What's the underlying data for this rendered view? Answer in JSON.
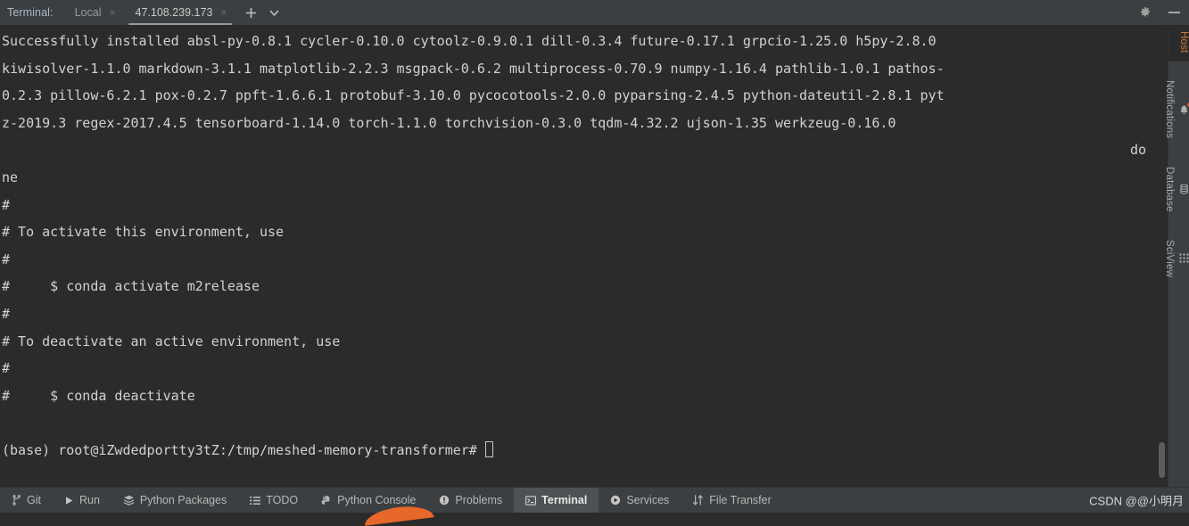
{
  "window": {
    "title_label": "Terminal:",
    "gear_icon": "gear-icon",
    "minimize_icon": "minimize-icon",
    "add_icon": "+",
    "dropdown_icon": "ˇ"
  },
  "tabs": [
    {
      "label": "Local",
      "active": false,
      "close_icon": "×"
    },
    {
      "label": "47.108.239.173",
      "active": true,
      "close_icon": "×"
    }
  ],
  "terminal": {
    "lines": [
      {
        "text": "Successfully installed absl-py-0.8.1 cycler-0.10.0 cytoolz-0.9.0.1 dill-0.3.4 future-0.17.1 grpcio-1.25.0 h5py-2.8.0",
        "align": "left"
      },
      {
        "text": "kiwisolver-1.1.0 markdown-3.1.1 matplotlib-2.2.3 msgpack-0.6.2 multiprocess-0.70.9 numpy-1.16.4 pathlib-1.0.1 pathos-",
        "align": "left"
      },
      {
        "text": "0.2.3 pillow-6.2.1 pox-0.2.7 ppft-1.6.6.1 protobuf-3.10.0 pycocotools-2.0.0 pyparsing-2.4.5 python-dateutil-2.8.1 pyt",
        "align": "left"
      },
      {
        "text": "z-2019.3 regex-2017.4.5 tensorboard-1.14.0 torch-1.1.0 torchvision-0.3.0 tqdm-4.32.2 ujson-1.35 werkzeug-0.16.0",
        "align": "left"
      },
      {
        "text": "do",
        "align": "right"
      },
      {
        "text": "ne",
        "align": "left"
      },
      {
        "text": "#",
        "align": "left"
      },
      {
        "text": "# To activate this environment, use",
        "align": "left"
      },
      {
        "text": "#",
        "align": "left"
      },
      {
        "text": "#     $ conda activate m2release",
        "align": "left"
      },
      {
        "text": "#",
        "align": "left"
      },
      {
        "text": "# To deactivate an active environment, use",
        "align": "left"
      },
      {
        "text": "#",
        "align": "left"
      },
      {
        "text": "#     $ conda deactivate",
        "align": "left"
      },
      {
        "text": "",
        "align": "left"
      }
    ],
    "prompt": "(base) root@iZwdedportty3tZ:/tmp/meshed-memory-transformer#"
  },
  "right_rail": [
    {
      "label": "Host",
      "icon": "",
      "active": true,
      "badge": false
    },
    {
      "label": "Notifications",
      "icon": "notification-bell-icon",
      "active": false,
      "badge": true
    },
    {
      "label": "Database",
      "icon": "database-icon",
      "active": false,
      "badge": false
    },
    {
      "label": "SciView",
      "icon": "sciview-grid-icon",
      "active": false,
      "badge": false
    }
  ],
  "status_bar": {
    "items": [
      {
        "label": "Git",
        "icon": "git-branch-icon",
        "active": false
      },
      {
        "label": "Run",
        "icon": "run-play-icon",
        "active": false
      },
      {
        "label": "Python Packages",
        "icon": "packages-stack-icon",
        "active": false
      },
      {
        "label": "TODO",
        "icon": "todo-list-icon",
        "active": false
      },
      {
        "label": "Python Console",
        "icon": "python-console-icon",
        "active": false
      },
      {
        "label": "Problems",
        "icon": "problems-warning-icon",
        "active": false
      },
      {
        "label": "Terminal",
        "icon": "terminal-prompt-icon",
        "active": true
      },
      {
        "label": "Services",
        "icon": "services-play-icon",
        "active": false
      },
      {
        "label": "File Transfer",
        "icon": "file-transfer-arrows-icon",
        "active": false
      }
    ],
    "watermark": "CSDN @@小明月"
  },
  "colors": {
    "terminal_bg": "#2b2b2b",
    "chrome_bg": "#3c3f41",
    "text": "#cfd2d4",
    "accent_orange": "#cc7832",
    "badge_red": "#e05a3a",
    "active_tab_bg": "#4e5254"
  }
}
